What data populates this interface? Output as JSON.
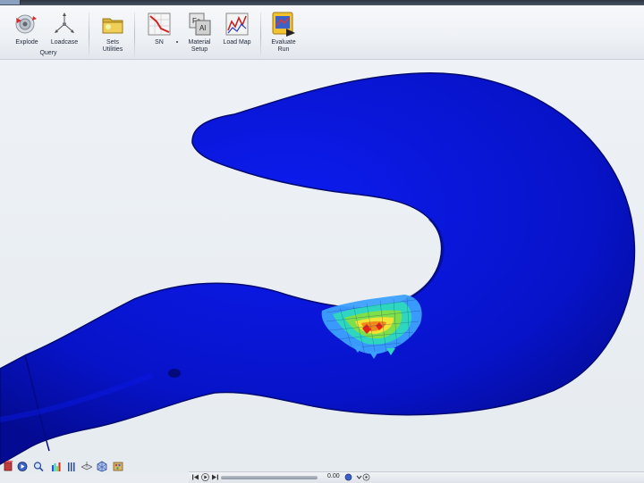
{
  "ribbon": {
    "buttons": [
      {
        "id": "explode",
        "label": "Explode"
      },
      {
        "id": "loadcase",
        "label": "Loadcase"
      },
      {
        "id": "sets",
        "label": "Sets\nUtilities"
      },
      {
        "id": "sn",
        "label": "SN"
      },
      {
        "id": "material",
        "label": "Material\nSetup"
      },
      {
        "id": "loadmap",
        "label": "Load Map"
      },
      {
        "id": "evaluate",
        "label": "Evaluate\nRun"
      }
    ],
    "groups": {
      "query": "Query"
    }
  },
  "viewport": {
    "model_color": "#0a14c8",
    "hotspot_colors": [
      "#3da0ff",
      "#2ed6c0",
      "#7de04a",
      "#f2e233",
      "#f08a1c",
      "#e0241a"
    ]
  },
  "bottom_toolbar": {
    "icons": [
      "cube-icon",
      "play-circle-icon",
      "zoom-icon",
      "legend-icon",
      "bars-icon",
      "plane-icon",
      "mesh-icon",
      "palette-icon"
    ]
  },
  "playback": {
    "time_value": "0.00"
  }
}
